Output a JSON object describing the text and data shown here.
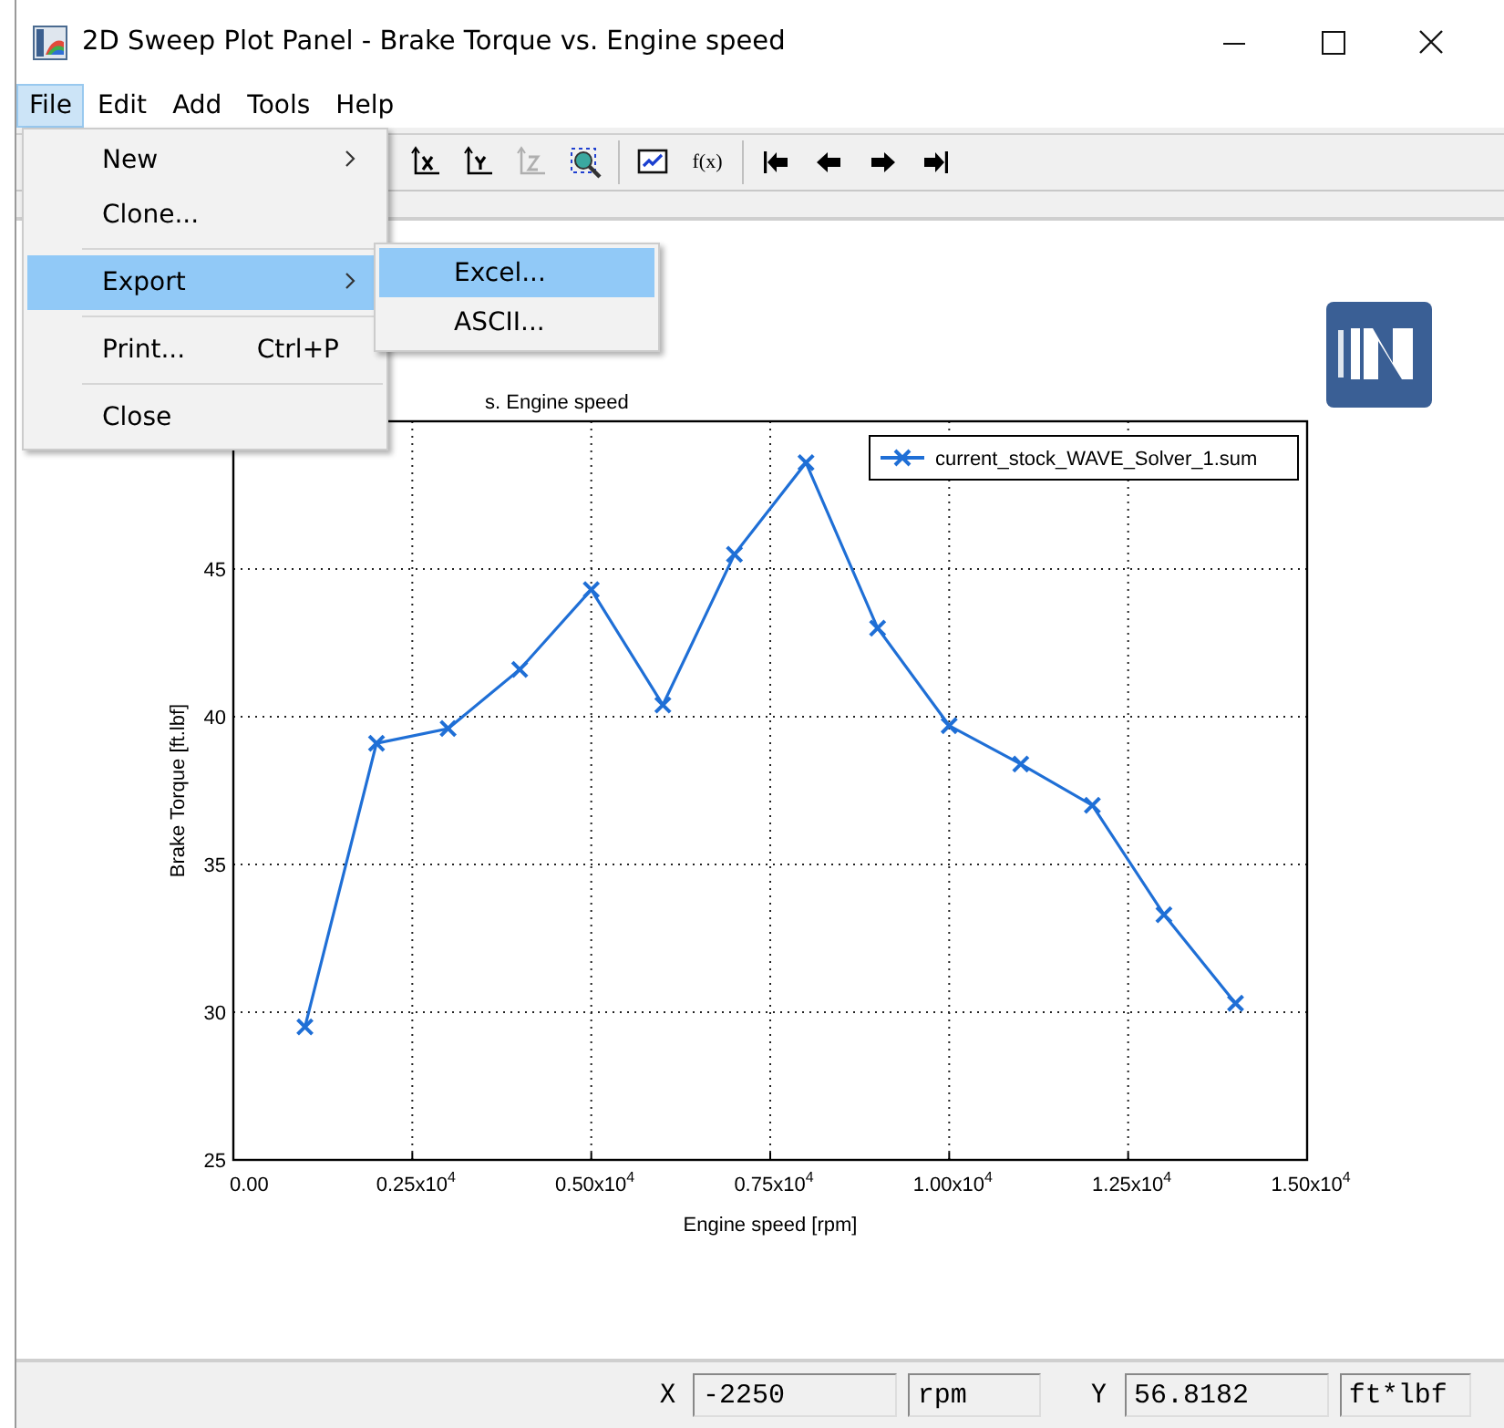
{
  "window": {
    "title": "2D Sweep Plot Panel - Brake Torque vs. Engine speed"
  },
  "menu_bar": [
    {
      "label": "File",
      "selected": true
    },
    {
      "label": "Edit",
      "selected": false
    },
    {
      "label": "Add",
      "selected": false
    },
    {
      "label": "Tools",
      "selected": false
    },
    {
      "label": "Help",
      "selected": false
    }
  ],
  "file_menu": [
    {
      "kind": "item",
      "label": "New",
      "submenu": true,
      "selected": false
    },
    {
      "kind": "item",
      "label": "Clone...",
      "submenu": false,
      "selected": false
    },
    {
      "kind": "separator"
    },
    {
      "kind": "item",
      "label": "Export",
      "submenu": true,
      "selected": true
    },
    {
      "kind": "separator"
    },
    {
      "kind": "item",
      "label": "Print...",
      "shortcut": "Ctrl+P",
      "submenu": false,
      "selected": false
    },
    {
      "kind": "separator"
    },
    {
      "kind": "item",
      "label": "Close",
      "submenu": false,
      "selected": false
    }
  ],
  "export_submenu": [
    {
      "label": "Excel...",
      "selected": true
    },
    {
      "label": "ASCII...",
      "selected": false
    }
  ],
  "toolbar": [
    {
      "kind": "x-axis",
      "disabled": false
    },
    {
      "kind": "y-axis",
      "disabled": false
    },
    {
      "kind": "z-axis",
      "disabled": true
    },
    {
      "kind": "zoom",
      "disabled": false
    },
    {
      "kind": "separator"
    },
    {
      "kind": "chart",
      "disabled": false
    },
    {
      "kind": "function",
      "label": "f(x)",
      "disabled": false
    },
    {
      "kind": "separator"
    },
    {
      "kind": "first",
      "disabled": false
    },
    {
      "kind": "previous",
      "disabled": false
    },
    {
      "kind": "next",
      "disabled": false
    },
    {
      "kind": "last",
      "disabled": false
    }
  ],
  "plot": {
    "chart_data": {
      "type": "line",
      "title": "s. Engine speed",
      "xlabel": "Engine speed  [rpm]",
      "ylabel": "Brake Torque  [ft.lbf]",
      "x": [
        1000,
        2000,
        3000,
        4000,
        5000,
        6000,
        7000,
        8000,
        9000,
        10000,
        11000,
        12000,
        13000,
        14000
      ],
      "grid": true,
      "series": [
        {
          "name": "current_stock_WAVE_Solver_1.sum",
          "color": "#1f6fd6",
          "marker": "x",
          "values": [
            29.5,
            39.1,
            39.6,
            41.6,
            44.3,
            40.4,
            45.5,
            48.6,
            43.0,
            39.7,
            38.4,
            37.0,
            33.3,
            30.3
          ]
        }
      ],
      "xlim": [
        0,
        15000
      ],
      "ylim": [
        25,
        50
      ],
      "xticks": [
        {
          "value": 0,
          "label": "0.00"
        },
        {
          "value": 2500,
          "label": "0.25x10$^{4}$"
        },
        {
          "value": 5000,
          "label": "0.50x10$^{4}$"
        },
        {
          "value": 7500,
          "label": "0.75x10$^{4}$"
        },
        {
          "value": 10000,
          "label": "1.00x10$^{4}$"
        },
        {
          "value": 12500,
          "label": "1.25x10$^{4}$"
        },
        {
          "value": 15000,
          "label": "1.50x10$^{4}$"
        }
      ],
      "yticks": [
        25,
        30,
        35,
        40,
        45
      ]
    }
  },
  "status_bar": [
    {
      "label": "X",
      "value": "-2250",
      "unit": "rpm"
    },
    {
      "label": "Y",
      "value": "56.8182",
      "unit": "ft*lbf"
    }
  ]
}
